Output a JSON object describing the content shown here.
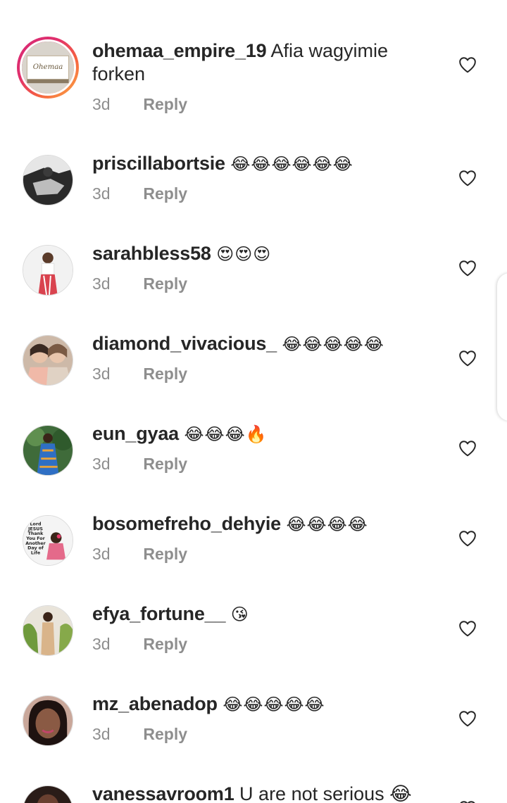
{
  "comments": [
    {
      "username": "ohemaa_empire_19",
      "text": "Afia wagyimie forken",
      "time": "3d",
      "reply": "Reply"
    },
    {
      "username": "priscillabortsie",
      "text": "😂😂😂😂😂😂",
      "time": "3d",
      "reply": "Reply"
    },
    {
      "username": "sarahbless58",
      "text": "😍😍😍",
      "time": "3d",
      "reply": "Reply"
    },
    {
      "username": "diamond_vivacious_",
      "text": "😂😂😂😂😂",
      "time": "3d",
      "reply": "Reply"
    },
    {
      "username": "eun_gyaa",
      "text": "😂😂😂🔥",
      "time": "3d",
      "reply": "Reply"
    },
    {
      "username": "bosomefreho_dehyie",
      "text": "😂😂😂😂",
      "time": "3d",
      "reply": "Reply"
    },
    {
      "username": "efya_fortune__",
      "text": "😘",
      "time": "3d",
      "reply": "Reply"
    },
    {
      "username": "mz_abenadop",
      "text": "😂😂😂😂😂",
      "time": "3d",
      "reply": "Reply"
    },
    {
      "username": "vanessavroom1",
      "text": "U are not serious 😂",
      "time": "",
      "reply": ""
    }
  ],
  "avatar_images": {
    "ohemaa_empire_19": {
      "text": "Ohemaa"
    },
    "bosomefreho_dehyie": {
      "lines": [
        "Lord",
        "JESUS",
        "Thank",
        "You For",
        "Another",
        "Day of",
        "Life"
      ]
    }
  },
  "icons": {
    "like": "heart-outline-icon"
  },
  "colors": {
    "text": "#262626",
    "secondary": "#8e8e8e",
    "story_ring_start": "#d62976",
    "story_ring_end": "#fcaf45"
  }
}
